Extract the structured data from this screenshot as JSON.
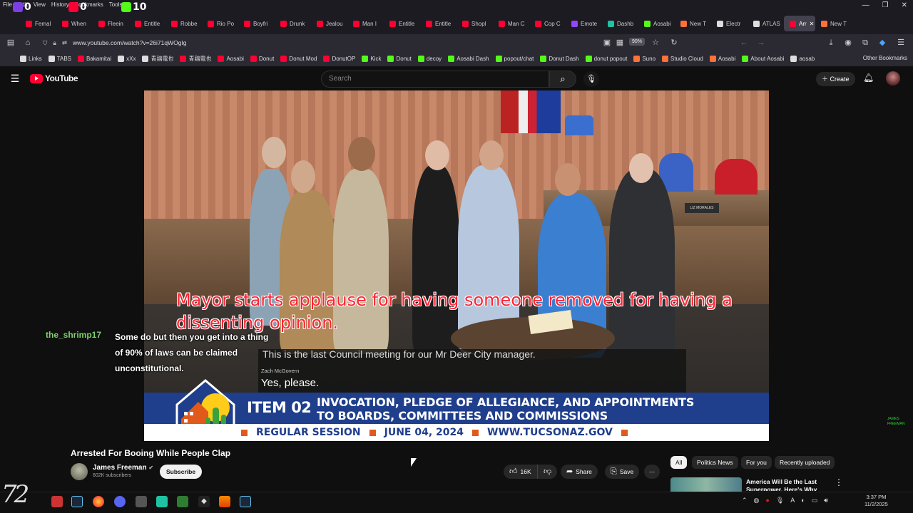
{
  "browser": {
    "menu": [
      "File",
      "Edit",
      "View",
      "History",
      "Bookmarks",
      "Tools"
    ],
    "streamer_badges": [
      {
        "value": "0",
        "color": "#7b3fe4"
      },
      {
        "value": "0",
        "color": "#ff0033"
      },
      {
        "value": "10",
        "color": "#53fc18"
      }
    ],
    "tabs": [
      {
        "label": "Femal",
        "color": "#ff0033"
      },
      {
        "label": "When",
        "color": "#ff0033"
      },
      {
        "label": "Fleein",
        "color": "#ff0033"
      },
      {
        "label": "Entitle",
        "color": "#ff0033"
      },
      {
        "label": "Robbe",
        "color": "#ff0033"
      },
      {
        "label": "Rio Po",
        "color": "#ff0033"
      },
      {
        "label": "Boyfri",
        "color": "#ff0033"
      },
      {
        "label": "Drunk",
        "color": "#ff0033"
      },
      {
        "label": "Jealou",
        "color": "#ff0033"
      },
      {
        "label": "Man I",
        "color": "#ff0033"
      },
      {
        "label": "Entitle",
        "color": "#ff0033"
      },
      {
        "label": "Entitle",
        "color": "#ff0033"
      },
      {
        "label": "Shopl",
        "color": "#ff0033"
      },
      {
        "label": "Man C",
        "color": "#ff0033"
      },
      {
        "label": "Cop C",
        "color": "#ff0033"
      },
      {
        "label": "Emote",
        "color": "#9146ff"
      },
      {
        "label": "Dashb",
        "color": "#1fc3a3"
      },
      {
        "label": "Aosabi",
        "color": "#53fc18"
      },
      {
        "label": "New T",
        "color": "#ff7139"
      },
      {
        "label": "Electr",
        "color": "#dddddd"
      },
      {
        "label": "ATLAS",
        "color": "#dddddd"
      },
      {
        "label": "Arr",
        "color": "#ff0033",
        "active": true
      },
      {
        "label": "New T",
        "color": "#ff7139"
      }
    ],
    "url": "www.youtube.com/watch?v=26i71qWOgIg",
    "zoom": "90%",
    "bookmarks": [
      {
        "label": "Links",
        "color": "#dddddd"
      },
      {
        "label": "TABS",
        "color": "#dddddd"
      },
      {
        "label": "Bakamitai",
        "color": "#ff0033"
      },
      {
        "label": "xXx",
        "color": "#dddddd"
      },
      {
        "label": "青鶏電也",
        "color": "#dddddd"
      },
      {
        "label": "青鶏電也",
        "color": "#ff0033"
      },
      {
        "label": "Aosabi",
        "color": "#ff0033"
      },
      {
        "label": "Donut",
        "color": "#ff0033"
      },
      {
        "label": "Donut Mod",
        "color": "#ff0033"
      },
      {
        "label": "DonutOP",
        "color": "#ff0033"
      },
      {
        "label": "Kick",
        "color": "#53fc18"
      },
      {
        "label": "Donut",
        "color": "#53fc18"
      },
      {
        "label": "decoy",
        "color": "#53fc18"
      },
      {
        "label": "Aosabi Dash",
        "color": "#53fc18"
      },
      {
        "label": "popout/chat",
        "color": "#53fc18"
      },
      {
        "label": "Donut Dash",
        "color": "#53fc18"
      },
      {
        "label": "donut popout",
        "color": "#53fc18"
      },
      {
        "label": "Suno",
        "color": "#ff7139"
      },
      {
        "label": "Studio Cloud",
        "color": "#ff7139"
      },
      {
        "label": "Aosabi",
        "color": "#ff7139"
      },
      {
        "label": "About Aosabi",
        "color": "#53fc18"
      },
      {
        "label": "aosab",
        "color": "#dddddd"
      }
    ],
    "other_bookmarks": "Other Bookmarks"
  },
  "youtube": {
    "logo": "YouTube",
    "search_placeholder": "Search",
    "create_label": "Create"
  },
  "video": {
    "overlay_text": "Mayor starts applause for having someone removed for having a dissenting opinion.",
    "caption_prev": "This is the last Council meeting for our Mr Deer City manager.",
    "caption_speaker": "Zach McGovern",
    "caption_line": "Yes, please.",
    "banner_item": "ITEM 02",
    "banner_title_1": "INVOCATION, PLEDGE OF ALLEGIANCE, AND APPOINTMENTS",
    "banner_title_2": "TO BOARDS, COMMITTEES AND COMMISSIONS",
    "banner_strip": [
      "REGULAR SESSION",
      "JUNE 04, 2024",
      "WWW.TUCSONAZ.GOV"
    ],
    "nameplates": [
      "LIZ MORALES"
    ]
  },
  "chat": {
    "user": "the_shrimp17",
    "message": "Some do but then you get into a thing of 90% of laws can be claimed unconstitutional."
  },
  "side_note": "JAMES\nFREEMAN",
  "watch": {
    "title": "Arrested For Booing While People Clap",
    "channel": "James Freeman",
    "subscribers": "602K subscribers",
    "subscribe": "Subscribe",
    "likes": "16K",
    "share": "Share",
    "save": "Save"
  },
  "chips": [
    "All",
    "Politics News",
    "For you",
    "Recently uploaded"
  ],
  "recommendation": {
    "title": "America Will Be the Last Superpower. Here's Why"
  },
  "taskbar": {
    "logo": "72",
    "time": "3:37 PM",
    "date": "11/2/2025"
  }
}
